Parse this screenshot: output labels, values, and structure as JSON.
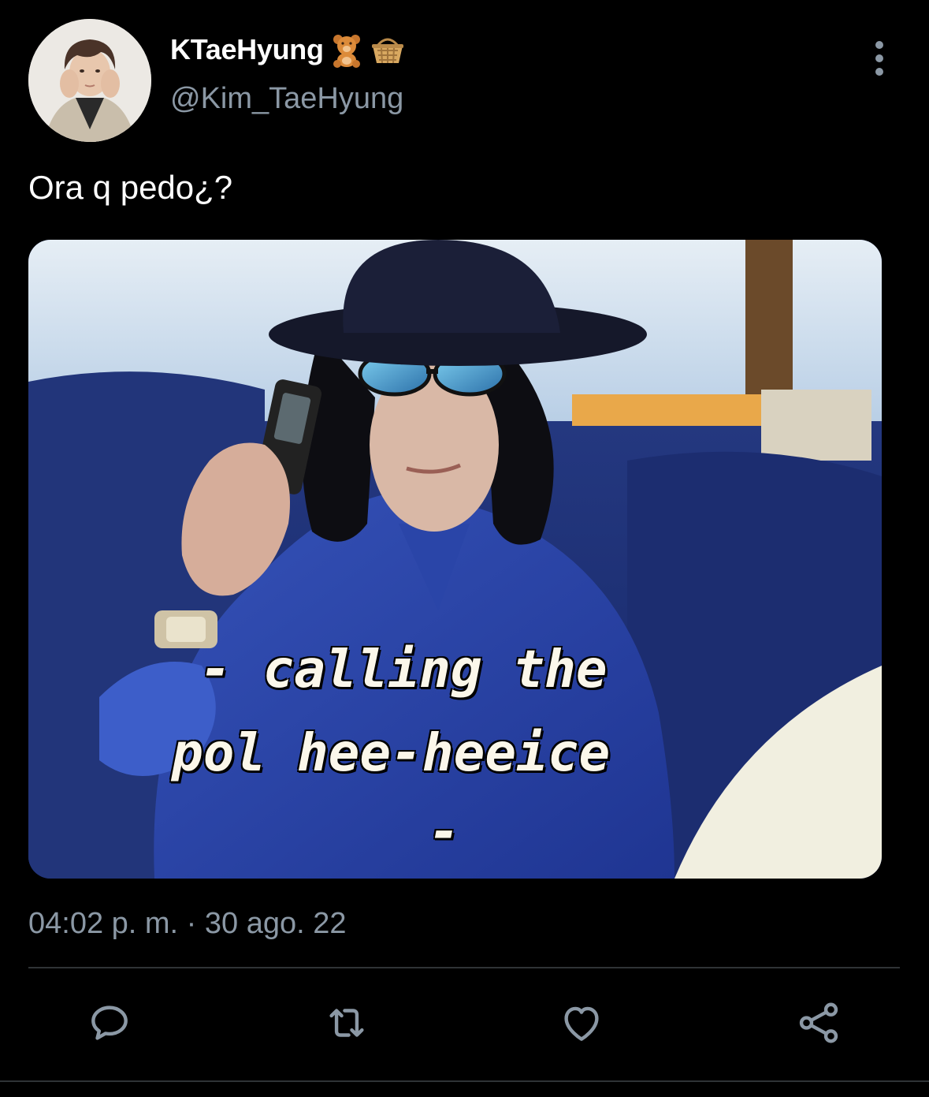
{
  "tweet": {
    "author": {
      "display_name": "KTaeHyung",
      "handle": "@Kim_TaeHyung",
      "name_emojis": [
        "teddy-bear-emoji",
        "basket-emoji"
      ]
    },
    "text": "Ora q pedo¿?",
    "media": {
      "caption_line_1": "- calling the",
      "caption_line_2": "pol hee-heeice",
      "caption_line_3": "-"
    },
    "timestamp": "04:02 p. m. · 30 ago. 22",
    "actions": [
      {
        "icon": "reply-icon"
      },
      {
        "icon": "retweet-icon"
      },
      {
        "icon": "like-icon"
      },
      {
        "icon": "share-icon"
      }
    ]
  },
  "colors": {
    "background": "#000000",
    "text_primary": "#ffffff",
    "text_secondary": "#8b98a5",
    "divider": "#2f3336"
  }
}
